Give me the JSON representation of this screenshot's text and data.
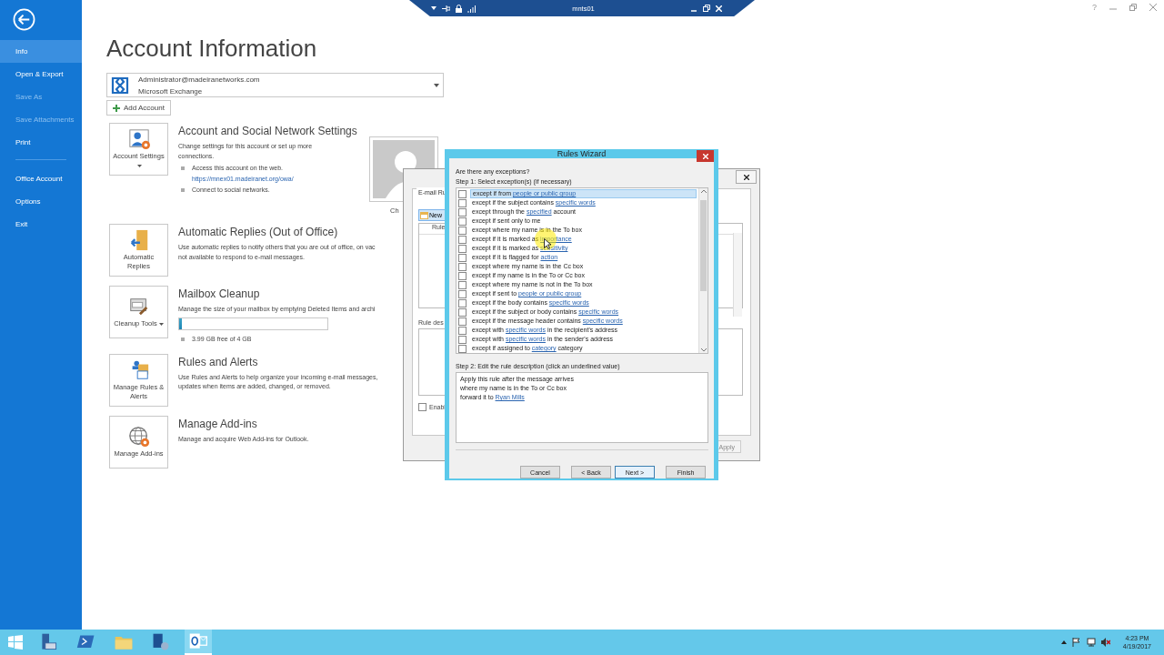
{
  "remote_bar": {
    "title": "mnts01"
  },
  "window_controls": {
    "help": "?"
  },
  "sidebar": {
    "items": [
      {
        "label": "Info",
        "selected": true,
        "disabled": false
      },
      {
        "label": "Open & Export",
        "selected": false,
        "disabled": false
      },
      {
        "label": "Save As",
        "selected": false,
        "disabled": true
      },
      {
        "label": "Save Attachments",
        "selected": false,
        "disabled": true
      },
      {
        "label": "Print",
        "selected": false,
        "disabled": false
      },
      {
        "label": "Office Account",
        "selected": false,
        "disabled": false
      },
      {
        "label": "Options",
        "selected": false,
        "disabled": false
      },
      {
        "label": "Exit",
        "selected": false,
        "disabled": false
      }
    ]
  },
  "page": {
    "title": "Account Information",
    "account": {
      "email": "Administrator@madeiranetworks.com",
      "type": "Microsoft Exchange"
    },
    "add_account": "Add Account",
    "sections": [
      {
        "kind": "settings",
        "tile": "Account Settings",
        "dropdown": true,
        "title": "Account and Social Network Settings",
        "description": [
          "Change settings for this account or set up more",
          "connections."
        ],
        "bullets": [
          {
            "text": "Access this account on the web.",
            "link": "https://mnex01.madeiranet.org/owa/"
          },
          {
            "text": "Connect to social networks."
          }
        ],
        "photo_caption": "Ch"
      },
      {
        "kind": "replies",
        "tile": "Automatic Replies",
        "dropdown": false,
        "title": "Automatic Replies (Out of Office)",
        "description": [
          "Use automatic replies to notify others that you are out of office, on vac",
          "not available to respond to e-mail messages."
        ]
      },
      {
        "kind": "cleanup",
        "tile": "Cleanup Tools",
        "dropdown": true,
        "title": "Mailbox Cleanup",
        "description": [
          "Manage the size of your mailbox by emptying Deleted Items and archi"
        ],
        "level": 0.02,
        "bullets": [
          {
            "text": "3.99 GB free of 4 GB"
          }
        ]
      },
      {
        "kind": "rules",
        "tile": "Manage Rules & Alerts",
        "dropdown": false,
        "title": "Rules and Alerts",
        "description": [
          "Use Rules and Alerts to help organize your incoming e-mail messages,",
          "updates when items are added, changed, or removed."
        ]
      },
      {
        "kind": "addins",
        "tile": "Manage Add-ins",
        "dropdown": false,
        "title": "Manage Add-ins",
        "description": [
          "Manage and acquire Web Add-ins for Outlook."
        ]
      }
    ]
  },
  "rules_dialog": {
    "tab": "E-mail Ru",
    "new_button": "New",
    "column": "Rule",
    "description_label": "Rule des",
    "enable": {
      "label": "Enabl",
      "checked": false
    },
    "apply_button": "Apply"
  },
  "wizard": {
    "title": "Rules Wizard",
    "question": "Are there any exceptions?",
    "step1": "Step 1: Select exception(s) (if necessary)",
    "rules": [
      {
        "checked": false,
        "selected": true,
        "parts": [
          {
            "text": "except if from ",
            "link": false
          },
          {
            "text": "people or public group",
            "link": true
          }
        ]
      },
      {
        "checked": false,
        "selected": false,
        "parts": [
          {
            "text": "except if the subject contains ",
            "link": false
          },
          {
            "text": "specific words",
            "link": true
          }
        ]
      },
      {
        "checked": false,
        "selected": false,
        "parts": [
          {
            "text": "except through the ",
            "link": false
          },
          {
            "text": "specified",
            "link": true
          },
          {
            "text": " account",
            "link": false
          }
        ]
      },
      {
        "checked": false,
        "selected": false,
        "parts": [
          {
            "text": "except if sent only to me",
            "link": false
          }
        ]
      },
      {
        "checked": false,
        "selected": false,
        "parts": [
          {
            "text": "except where my name is in the To box",
            "link": false
          }
        ]
      },
      {
        "checked": false,
        "selected": false,
        "parts": [
          {
            "text": "except if it is marked as ",
            "link": false
          },
          {
            "text": "importance",
            "link": true
          }
        ]
      },
      {
        "checked": false,
        "selected": false,
        "parts": [
          {
            "text": "except if it is marked as ",
            "link": false
          },
          {
            "text": "sensitivity",
            "link": true
          }
        ]
      },
      {
        "checked": false,
        "selected": false,
        "parts": [
          {
            "text": "except if it is flagged for ",
            "link": false
          },
          {
            "text": "action",
            "link": true
          }
        ]
      },
      {
        "checked": false,
        "selected": false,
        "parts": [
          {
            "text": "except where my name is in the Cc box",
            "link": false
          }
        ]
      },
      {
        "checked": false,
        "selected": false,
        "parts": [
          {
            "text": "except if my name is in the To or Cc box",
            "link": false
          }
        ]
      },
      {
        "checked": false,
        "selected": false,
        "parts": [
          {
            "text": "except where my name is not in the To box",
            "link": false
          }
        ]
      },
      {
        "checked": false,
        "selected": false,
        "parts": [
          {
            "text": "except if sent to ",
            "link": false
          },
          {
            "text": "people or public group",
            "link": true
          }
        ]
      },
      {
        "checked": false,
        "selected": false,
        "parts": [
          {
            "text": "except if the body contains ",
            "link": false
          },
          {
            "text": "specific words",
            "link": true
          }
        ]
      },
      {
        "checked": false,
        "selected": false,
        "parts": [
          {
            "text": "except if the subject or body contains ",
            "link": false
          },
          {
            "text": "specific words",
            "link": true
          }
        ]
      },
      {
        "checked": false,
        "selected": false,
        "parts": [
          {
            "text": "except if the message header contains ",
            "link": false
          },
          {
            "text": "specific words",
            "link": true
          }
        ]
      },
      {
        "checked": false,
        "selected": false,
        "parts": [
          {
            "text": "except with ",
            "link": false
          },
          {
            "text": "specific words",
            "link": true
          },
          {
            "text": " in the recipient's address",
            "link": false
          }
        ]
      },
      {
        "checked": false,
        "selected": false,
        "parts": [
          {
            "text": "except with ",
            "link": false
          },
          {
            "text": "specific words",
            "link": true
          },
          {
            "text": " in the sender's address",
            "link": false
          }
        ]
      },
      {
        "checked": false,
        "selected": false,
        "parts": [
          {
            "text": "except if assigned to ",
            "link": false
          },
          {
            "text": "category",
            "link": true
          },
          {
            "text": " category",
            "link": false
          }
        ]
      }
    ],
    "step2": "Step 2: Edit the rule description (click an underlined value)",
    "description": [
      {
        "parts": [
          {
            "text": "Apply this rule after the message arrives",
            "link": false
          }
        ]
      },
      {
        "parts": [
          {
            "text": "where my name is in the To or Cc box",
            "link": false
          }
        ]
      },
      {
        "parts": [
          {
            "text": "forward it to ",
            "link": false
          },
          {
            "text": "Ryan Mills",
            "link": true
          }
        ]
      }
    ],
    "buttons": [
      {
        "label": "Cancel",
        "focused": false
      },
      {
        "label": "< Back",
        "focused": false
      },
      {
        "label": "Next >",
        "focused": true
      },
      {
        "label": "Finish",
        "focused": false
      }
    ]
  },
  "taskbar": {
    "apps": [
      {
        "kind": "server",
        "selected": false
      },
      {
        "kind": "powershell",
        "selected": false
      },
      {
        "kind": "explorer",
        "selected": false
      },
      {
        "kind": "network",
        "selected": false
      },
      {
        "kind": "outlook",
        "selected": true
      }
    ],
    "time": "4:23 PM",
    "date": "4/19/2017"
  }
}
